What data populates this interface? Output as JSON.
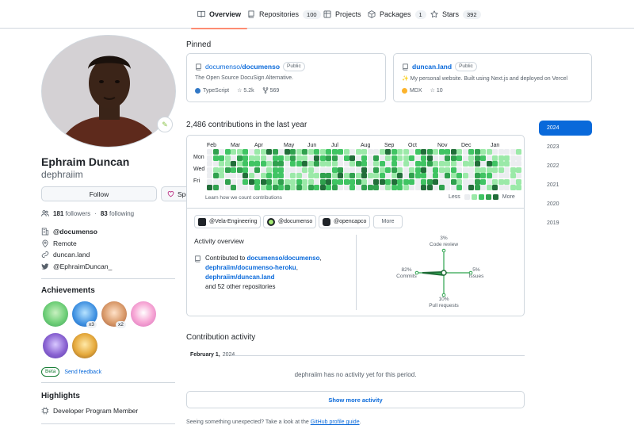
{
  "tabs": [
    {
      "label": "Overview",
      "count": "",
      "icon": "book-icon",
      "active": true
    },
    {
      "label": "Repositories",
      "count": "100",
      "icon": "repo-icon",
      "active": false
    },
    {
      "label": "Projects",
      "count": "",
      "icon": "table-icon",
      "active": false
    },
    {
      "label": "Packages",
      "count": "1",
      "icon": "package-icon",
      "active": false
    },
    {
      "label": "Stars",
      "count": "392",
      "icon": "star-icon",
      "active": false
    }
  ],
  "profile": {
    "name": "Ephraim Duncan",
    "username": "dephraiim",
    "follow_label": "Follow",
    "sponsor_label": "Sponsor",
    "followers_count": "181",
    "followers_label": "followers",
    "following_count": "83",
    "following_label": "following",
    "org": "@documenso",
    "location": "Remote",
    "website": "duncan.land",
    "twitter": "@EphraimDuncan_"
  },
  "achievements": {
    "title": "Achievements",
    "counts": [
      "x3",
      "x2"
    ],
    "beta_label": "Beta",
    "feedback_label": "Send feedback"
  },
  "highlights": {
    "title": "Highlights",
    "item": "Developer Program Member"
  },
  "pinned": {
    "title": "Pinned",
    "repos": [
      {
        "owner": "documenso/",
        "name": "documenso",
        "visibility": "Public",
        "description": "The Open Source DocuSign Alternative.",
        "language": "TypeScript",
        "lang_color": "#3178c6",
        "stars": "5.2k",
        "forks": "569"
      },
      {
        "owner": "",
        "name": "duncan.land",
        "visibility": "Public",
        "description": "✨ My personal website. Built using Next.js and deployed on Vercel",
        "language": "MDX",
        "lang_color": "#fcb32c",
        "stars": "10",
        "forks": ""
      }
    ]
  },
  "contributions": {
    "title": "2,486 contributions in the last year",
    "months": [
      "Feb",
      "Mar",
      "Apr",
      "May",
      "Jun",
      "Jul",
      "Aug",
      "Sep",
      "Oct",
      "Nov",
      "Dec",
      "Jan"
    ],
    "days": [
      "Mon",
      "Wed",
      "Fri"
    ],
    "learn_label": "Learn how we count contributions",
    "less_label": "Less",
    "more_label": "More",
    "legend_colors": [
      "#ebedf0",
      "#9be9a8",
      "#40c463",
      "#30a14e",
      "#216e39"
    ]
  },
  "years": [
    "2024",
    "2023",
    "2022",
    "2021",
    "2020",
    "2019"
  ],
  "orgs": [
    "@Vela-Engineering",
    "@documenso",
    "@opencapco"
  ],
  "orgs_more": "More",
  "activity_overview": {
    "title": "Activity overview",
    "contributed_prefix": "Contributed to",
    "repos": [
      "documenso/documenso",
      "dephraiim/documenso-heroku",
      "dephraiim/duncan.land"
    ],
    "others": "and 52 other repositories",
    "axes": {
      "code_review": {
        "pct": "3%",
        "label": "Code review"
      },
      "commits": {
        "pct": "82%",
        "label": "Commits"
      },
      "issues": {
        "pct": "5%",
        "label": "Issues"
      },
      "pull_requests": {
        "pct": "10%",
        "label": "Pull requests"
      }
    }
  },
  "contribution_activity": {
    "title": "Contribution activity",
    "month_label": "February 1,",
    "year_label": "2024",
    "empty_text": "dephraiim has no activity yet for this period.",
    "show_more": "Show more activity",
    "footer_prefix": "Seeing something unexpected? Take a look at the",
    "footer_link": "GitHub profile guide",
    "footer_suffix": "."
  }
}
